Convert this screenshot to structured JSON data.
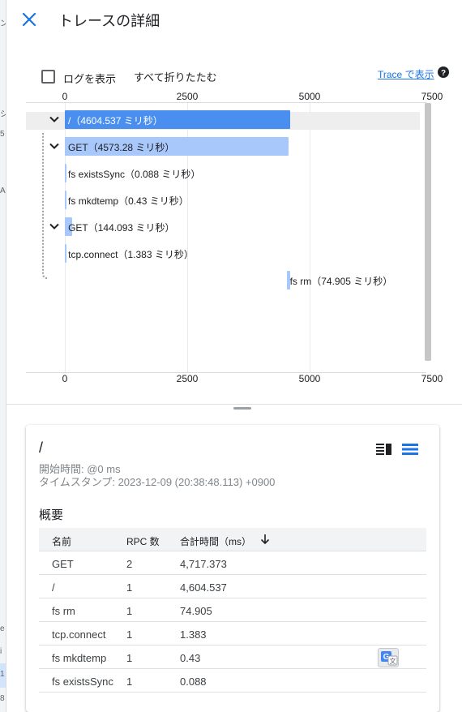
{
  "header": {
    "title": "トレースの詳細",
    "close_icon": "close-icon"
  },
  "toolbar": {
    "show_logs_label": "ログを表示",
    "show_logs_checked": false,
    "collapse_all_label": "すべて折りたたむ",
    "trace_link_label": "Trace で表示",
    "help_icon": "help-icon"
  },
  "timeline": {
    "top_ticks": [
      "0",
      "2500",
      "5000",
      "7500"
    ],
    "bottom_ticks": [
      "0",
      "2500",
      "5000",
      "7500"
    ],
    "axis_max": 7500,
    "spans": [
      {
        "label": "/（4604.537 ミリ秒）",
        "start": 0,
        "duration": 4604.537,
        "depth": 0,
        "expandable": true
      },
      {
        "label": "GET（4573.28 ミリ秒）",
        "start": 0,
        "duration": 4573.28,
        "depth": 1,
        "expandable": true
      },
      {
        "label": "fs existsSync（0.088 ミリ秒）",
        "start": 0.5,
        "duration": 0.088,
        "depth": 1,
        "expandable": false
      },
      {
        "label": "fs mkdtemp（0.43 ミリ秒）",
        "start": 1,
        "duration": 0.43,
        "depth": 1,
        "expandable": false
      },
      {
        "label": "GET（144.093 ミリ秒）",
        "start": 1.5,
        "duration": 144.093,
        "depth": 2,
        "expandable": true
      },
      {
        "label": "tcp.connect（1.383 ミリ秒）",
        "start": 2,
        "duration": 1.383,
        "depth": 3,
        "expandable": false
      },
      {
        "label": "fs rm（74.905 ミリ秒）",
        "start": 4529.6,
        "duration": 74.905,
        "depth": 1,
        "expandable": false
      }
    ]
  },
  "detail": {
    "title": "/",
    "start_time": "開始時間: @0 ms",
    "timestamp": "タイムスタンプ: 2023-12-09 (20:38:48.113) +0900",
    "summary_title": "概要",
    "columns": [
      "名前",
      "RPC 数",
      "合計時間（ms）"
    ],
    "rows": [
      [
        "GET",
        "2",
        "4,717.373"
      ],
      [
        "/",
        "1",
        "4,604.537"
      ],
      [
        "fs rm",
        "1",
        "74.905"
      ],
      [
        "tcp.connect",
        "1",
        "1.383"
      ],
      [
        "fs mkdtemp",
        "1",
        "0.43"
      ],
      [
        "fs existsSync",
        "1",
        "0.088"
      ]
    ]
  },
  "colors": {
    "accent": "#1a73e8",
    "root_bar": "#4a8ff0",
    "child_bar": "#a8c7fa"
  }
}
